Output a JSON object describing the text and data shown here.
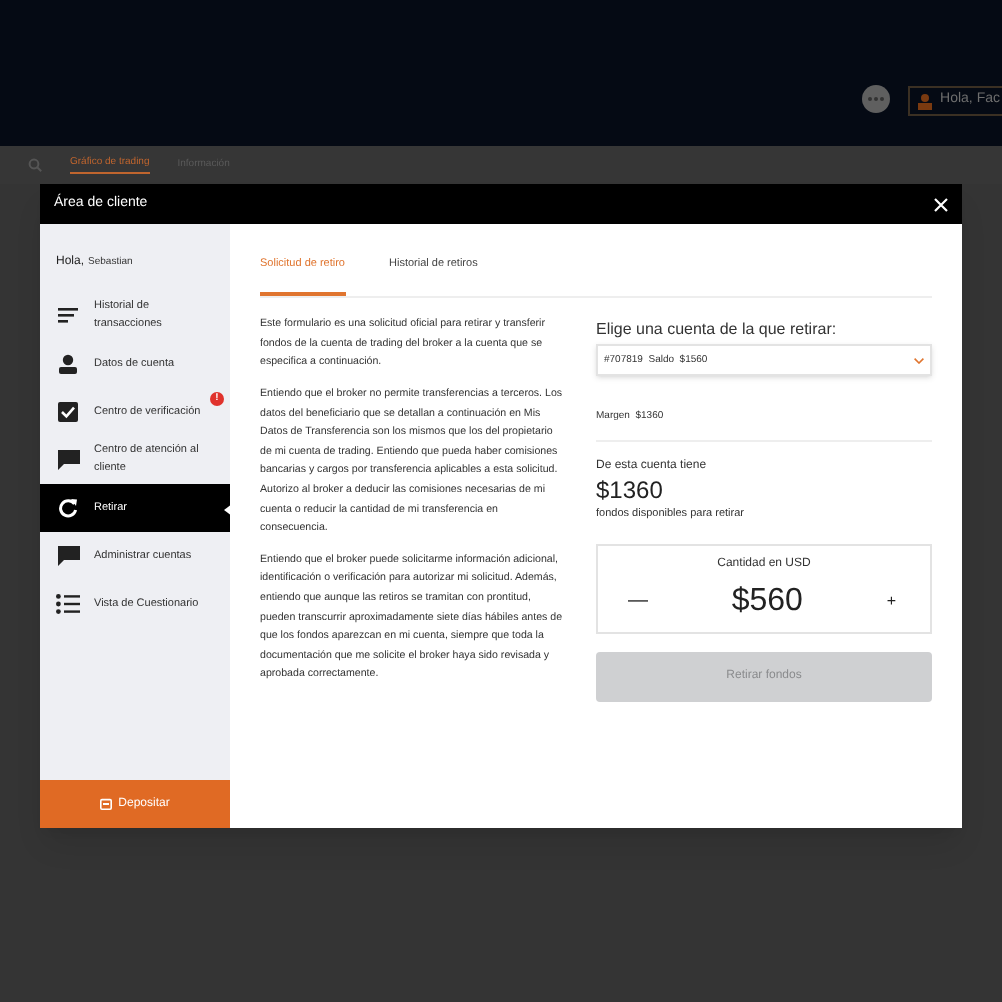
{
  "header": {
    "user_button": "Hola, Fac"
  },
  "page_tabs": [
    {
      "label": "Gráfico de trading",
      "selected": true
    },
    {
      "label": "Información",
      "selected": false
    }
  ],
  "modal": {
    "title": "Área de cliente",
    "greeting": {
      "label": "Hola,",
      "name": "Sebastian"
    },
    "sidebar_items": [
      {
        "label": "Historial de transacciones",
        "kind": "lines",
        "selected": false
      },
      {
        "label": "Datos de cuenta",
        "kind": "user",
        "selected": false
      },
      {
        "label": "Centro de verificación",
        "kind": "check",
        "selected": false,
        "badge": "!"
      },
      {
        "label": "Centro de atención al cliente",
        "kind": "chat",
        "selected": false
      },
      {
        "label": "Retirar",
        "kind": "refresh",
        "selected": true
      },
      {
        "label": "Administrar cuentas",
        "kind": "chat",
        "selected": false
      },
      {
        "label": "Vista de Cuestionario",
        "kind": "list",
        "selected": false
      }
    ],
    "deposit_button": "Depositar",
    "tabs": [
      {
        "label": "Solicitud de retiro",
        "selected": true
      },
      {
        "label": "Historial de retiros",
        "selected": false
      }
    ],
    "paragraphs": [
      "Este formulario es una solicitud oficial para retirar y transferir fondos de la cuenta de trading del broker a la cuenta que se especifica a continuación.",
      "Entiendo que el broker no permite transferencias a terceros. Los datos del beneficiario que se detallan a continuación en Mis Datos de Transferencia son los mismos que los del propietario de mi cuenta de trading. Entiendo que pueda haber comisiones bancarias y cargos por transferencia aplicables a esta solicitud. Autorizo al broker a deducir las comisiones necesarias de mi cuenta o reducir la cantidad de mi transferencia en consecuencia.",
      "Entiendo que el broker puede solicitarme información adicional, identificación o verificación para autorizar mi solicitud. Además, entiendo que aunque las retiros se tramitan con prontitud, pueden transcurrir aproximadamente siete días hábiles antes de que los fondos aparezcan en mi cuenta, siempre que toda la documentación que me solicite el broker haya sido revisada y aprobada correctamente."
    ],
    "account_heading": "Elige una cuenta de la que retirar:",
    "account_select": "#707819  Saldo  $1560",
    "margin": "Margen  $1360",
    "available_intro": "De esta cuenta tiene",
    "available_amount": "$1360",
    "available_caption": "fondos disponibles para retirar",
    "amount_label": "Cantidad en USD",
    "minus": "—",
    "amount": "$560",
    "plus": "+",
    "submit_button": {
      "label": "Retirar fondos",
      "disabled": true
    }
  }
}
